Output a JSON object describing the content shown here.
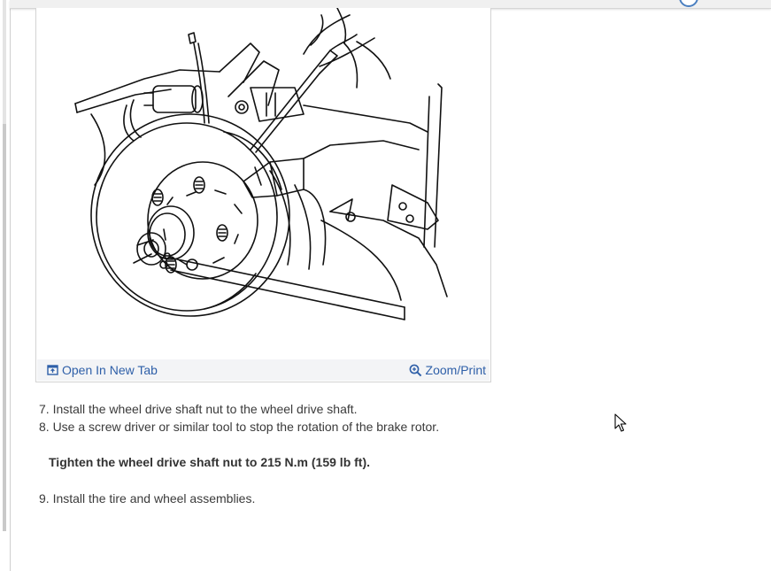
{
  "figure": {
    "open_new_tab_label": "Open In New Tab",
    "zoom_print_label": "Zoom/Print"
  },
  "steps": {
    "step7": "7. Install the wheel drive shaft nut to the wheel drive shaft.",
    "step8": "8. Use a screw driver or similar tool to stop the rotation of the brake rotor.",
    "torque_note": "Tighten the wheel drive shaft nut to 215 N.m (159 lb ft).",
    "step9": "9. Install the tire and wheel assemblies."
  },
  "icons": {
    "open_new_tab": "open-new-tab-icon",
    "zoom": "zoom-in-icon"
  },
  "colors": {
    "link": "#2e5fa8",
    "footer_bg": "#f3f4f6",
    "text": "#3a3a3a"
  }
}
